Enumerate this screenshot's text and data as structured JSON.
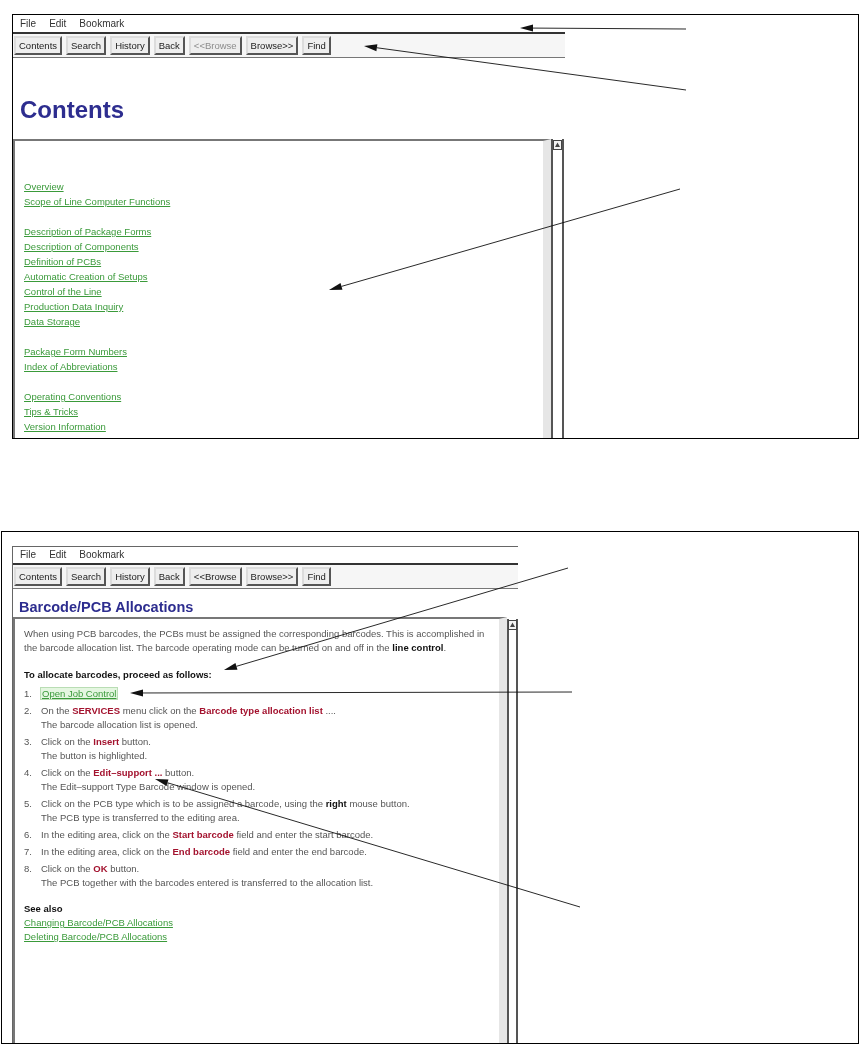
{
  "top_screen": {
    "menu": [
      "File",
      "Edit",
      "Bookmark"
    ],
    "toolbar": [
      {
        "label": "Contents",
        "disabled": false
      },
      {
        "label": "Search",
        "disabled": false
      },
      {
        "label": "History",
        "disabled": false
      },
      {
        "label": "Back",
        "disabled": false
      },
      {
        "label": "<<Browse",
        "disabled": true
      },
      {
        "label": "Browse>>",
        "disabled": false
      },
      {
        "label": "Find",
        "disabled": false
      }
    ],
    "heading": "Contents",
    "link_groups": [
      [
        "Overview",
        "Scope of Line Computer Functions"
      ],
      [
        "Description of Package Forms",
        "Description of Components",
        "Definition of PCBs",
        "Automatic Creation of Setups",
        "Control of the Line",
        "Production Data Inquiry",
        "Data Storage"
      ],
      [
        "Package Form Numbers",
        "Index of Abbreviations"
      ],
      [
        "Operating Conventions",
        "Tips & Tricks",
        "Version Information"
      ]
    ]
  },
  "bottom_screen": {
    "menu": [
      "File",
      "Edit",
      "Bookmark"
    ],
    "toolbar": [
      {
        "label": "Contents",
        "disabled": false
      },
      {
        "label": "Search",
        "disabled": false
      },
      {
        "label": "History",
        "disabled": false
      },
      {
        "label": "Back",
        "disabled": false
      },
      {
        "label": "<<Browse",
        "disabled": false
      },
      {
        "label": "Browse>>",
        "disabled": false
      },
      {
        "label": "Find",
        "disabled": false
      }
    ],
    "heading": "Barcode/PCB Allocations",
    "intro": [
      {
        "kind": "text",
        "text": "When using PCB barcodes, the PCBs must be assigned the corresponding barcodes. This is accomplished in the barcode allocation list. The barcode operating mode can be turned on and off in the "
      },
      {
        "kind": "bold",
        "text": "line control"
      },
      {
        "kind": "text",
        "text": "."
      }
    ],
    "steps_title": "To allocate barcodes, proceed as follows:",
    "steps": [
      {
        "number": "1.",
        "kind": "link",
        "link": {
          "text": "Open Job Control",
          "focused": true
        }
      },
      {
        "number": "2.",
        "kind": "action",
        "parts": [
          {
            "kind": "text",
            "text": "On the "
          },
          {
            "kind": "ui",
            "text": "SERVICES"
          },
          {
            "kind": "text",
            "text": " menu click on the "
          },
          {
            "kind": "ui",
            "text": "Barcode type allocation list"
          },
          {
            "kind": "text",
            "text": " ...."
          }
        ],
        "result": "The barcode allocation list is opened."
      },
      {
        "number": "3.",
        "kind": "action",
        "parts": [
          {
            "kind": "text",
            "text": "Click on the "
          },
          {
            "kind": "ui",
            "text": "Insert"
          },
          {
            "kind": "text",
            "text": " button."
          }
        ],
        "result": "The button is highlighted."
      },
      {
        "number": "4.",
        "kind": "action",
        "parts": [
          {
            "kind": "text",
            "text": "Click on the "
          },
          {
            "kind": "ui",
            "text": "Edit–support ..."
          },
          {
            "kind": "text",
            "text": " button."
          }
        ],
        "result": "The Edit–support Type Barcode window is opened."
      },
      {
        "number": "5.",
        "kind": "action",
        "parts": [
          {
            "kind": "text",
            "text": "Click on the PCB type which is to be assigned a barcode, using the "
          },
          {
            "kind": "bold",
            "text": "right"
          },
          {
            "kind": "text",
            "text": " mouse button."
          }
        ],
        "result": "The PCB type is transferred to the editing area."
      },
      {
        "number": "6.",
        "kind": "action",
        "parts": [
          {
            "kind": "text",
            "text": "In the editing area, click on the "
          },
          {
            "kind": "ui",
            "text": "Start barcode"
          },
          {
            "kind": "text",
            "text": " field and enter the start barcode."
          }
        ]
      },
      {
        "number": "7.",
        "kind": "action",
        "parts": [
          {
            "kind": "text",
            "text": "In the editing area, click on the "
          },
          {
            "kind": "ui",
            "text": "End barcode"
          },
          {
            "kind": "text",
            "text": " field and enter the end barcode."
          }
        ]
      },
      {
        "number": "8.",
        "kind": "action",
        "parts": [
          {
            "kind": "text",
            "text": "Click on the "
          },
          {
            "kind": "ui",
            "text": "OK"
          },
          {
            "kind": "text",
            "text": " button."
          }
        ],
        "result": "The PCB together with the barcodes entered is transferred to the allocation list."
      }
    ],
    "see_also_title": "See also",
    "see_also_links": [
      "Changing Barcode/PCB Allocations",
      "Deleting Barcode/PCB Allocations"
    ]
  }
}
